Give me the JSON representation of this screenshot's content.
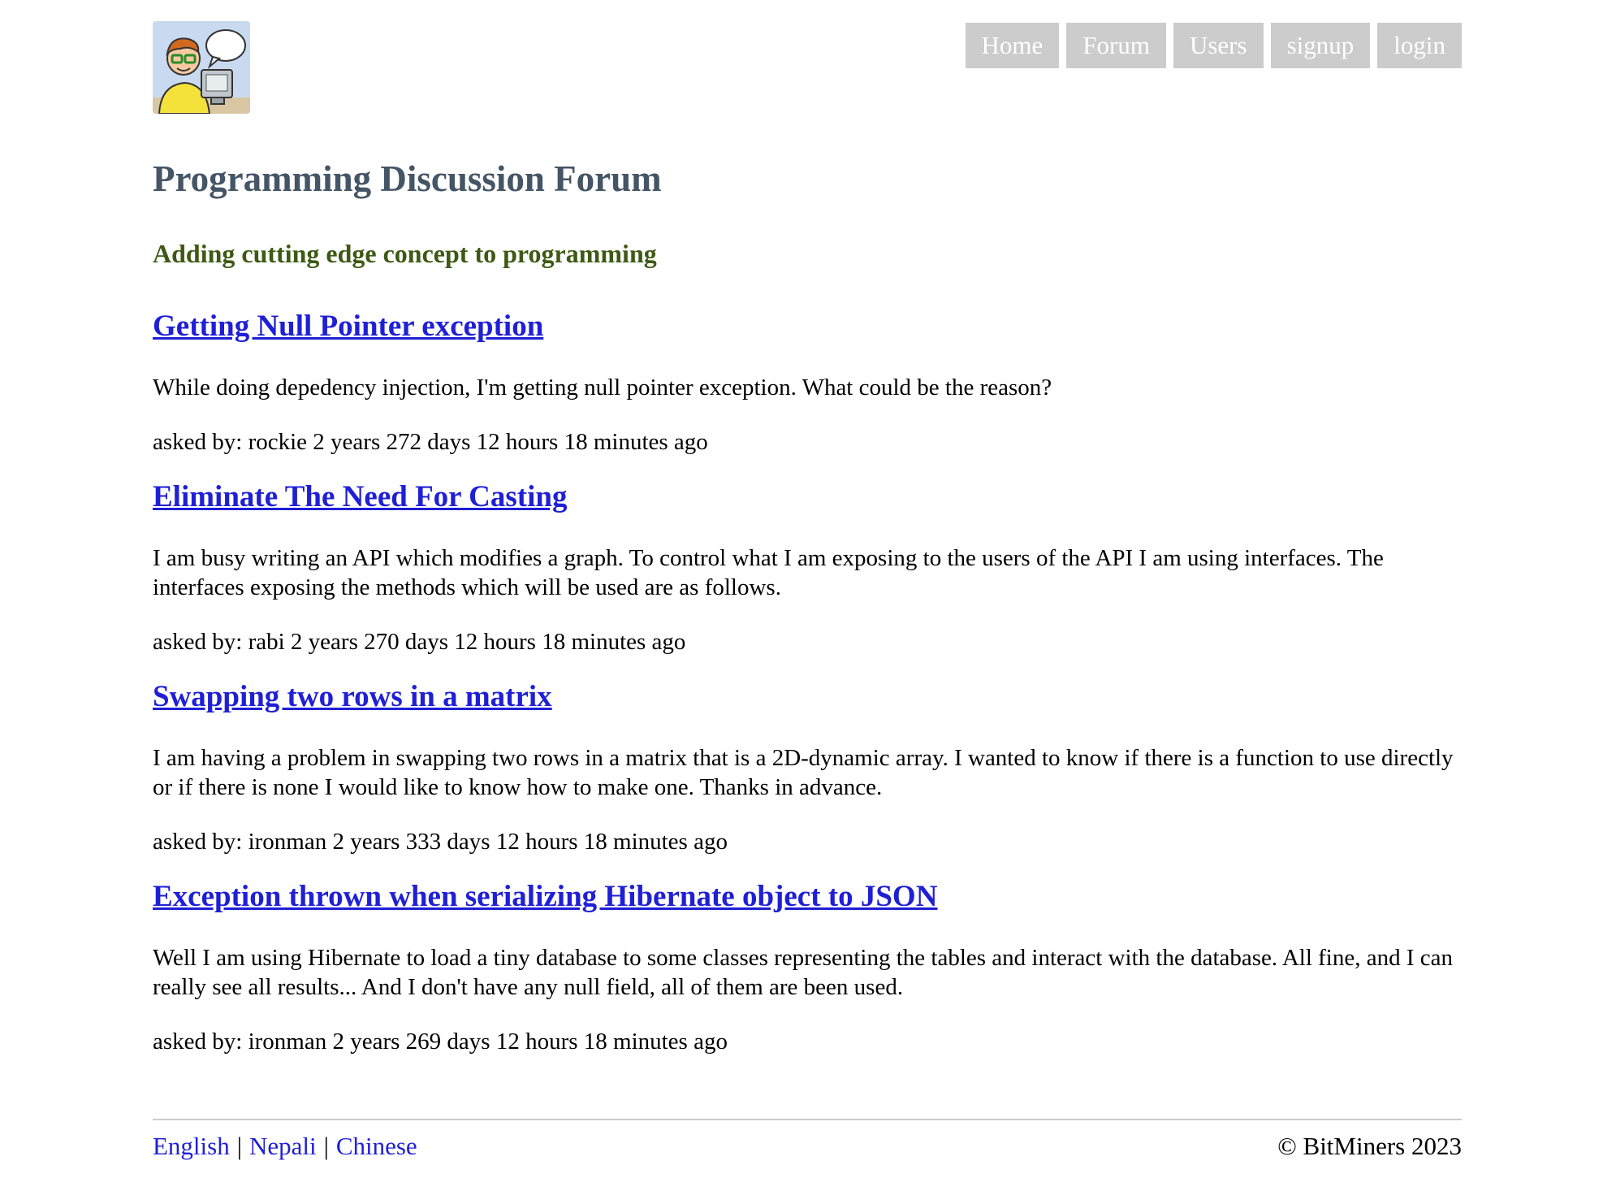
{
  "header": {
    "logo_icon": "programmer-at-computer-icon",
    "nav": [
      "Home",
      "Forum",
      "Users",
      "signup",
      "login"
    ]
  },
  "page": {
    "title": "Programming Discussion Forum",
    "tagline": "Adding cutting edge concept to programming"
  },
  "posts": [
    {
      "title": "Getting Null Pointer exception",
      "body": "While doing depedency injection, I'm getting null pointer exception. What could be the reason?",
      "meta": "asked by: rockie 2 years 272 days 12 hours 18 minutes ago"
    },
    {
      "title": "Eliminate The Need For Casting",
      "body": "I am busy writing an API which modifies a graph. To control what I am exposing to the users of the API I am using interfaces. The interfaces exposing the methods which will be used are as follows.",
      "meta": "asked by: rabi 2 years 270 days 12 hours 18 minutes ago"
    },
    {
      "title": "Swapping two rows in a matrix",
      "body": "I am having a problem in swapping two rows in a matrix that is a 2D-dynamic array. I wanted to know if there is a function to use directly or if there is none I would like to know how to make one. Thanks in advance.",
      "meta": "asked by: ironman 2 years 333 days 12 hours 18 minutes ago"
    },
    {
      "title": "Exception thrown when serializing Hibernate object to JSON",
      "body": "Well I am using Hibernate to load a tiny database to some classes representing the tables and interact with the database. All fine, and I can really see all results... And I don't have any null field, all of them are been used.",
      "meta": "asked by: ironman 2 years 269 days 12 hours 18 minutes ago"
    }
  ],
  "footer": {
    "languages": [
      "English",
      "Nepali",
      "Chinese"
    ],
    "separator": "|",
    "copyright": "© BitMiners 2023"
  }
}
